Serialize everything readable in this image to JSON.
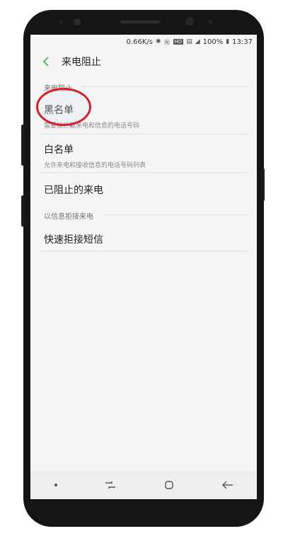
{
  "status_bar": {
    "speed": "0.66K/s",
    "icons": [
      "bluetooth-icon",
      "nfc-icon",
      "hd-badge",
      "data-icon",
      "signal-icon"
    ],
    "hd_label": "HD",
    "battery": "100%",
    "time": "13:37"
  },
  "app_bar": {
    "title": "来电阻止"
  },
  "sections": [
    {
      "header": "来电阻止",
      "items": [
        {
          "title": "黑名单",
          "subtitle": "需要被拦截来电和信息的电话号码"
        },
        {
          "title": "白名单",
          "subtitle": "允许来电和接收信息的电话号码列表"
        },
        {
          "title": "已阻止的来电",
          "subtitle": ""
        }
      ]
    },
    {
      "header": "以信息拒接来电",
      "items": [
        {
          "title": "快速拒接短信",
          "subtitle": ""
        }
      ]
    }
  ],
  "colors": {
    "accent": "#4caf50",
    "annotation": "#d81e2c"
  }
}
